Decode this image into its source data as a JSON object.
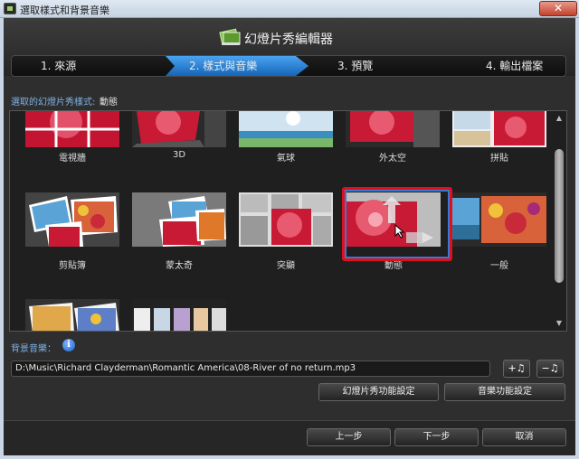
{
  "window": {
    "title": "選取樣式和背景音樂",
    "close_glyph": "✕"
  },
  "header": {
    "app_title": "幻燈片秀編輯器"
  },
  "steps": [
    {
      "label": "1. 來源",
      "active": false
    },
    {
      "label": "2. 樣式與音樂",
      "active": true
    },
    {
      "label": "3. 預覽",
      "active": false
    },
    {
      "label": "4. 輸出檔案",
      "active": false
    }
  ],
  "style_selection": {
    "label": "選取的幻燈片秀樣式:",
    "value": "動態"
  },
  "styles": [
    {
      "label": "電視牆"
    },
    {
      "label": "3D"
    },
    {
      "label": "氣球"
    },
    {
      "label": "外太空"
    },
    {
      "label": "拼貼"
    },
    {
      "label": "剪貼簿"
    },
    {
      "label": "蒙太奇"
    },
    {
      "label": "突顯"
    },
    {
      "label": "動態",
      "selected": true
    },
    {
      "label": "一般"
    },
    {
      "label": ""
    },
    {
      "label": ""
    }
  ],
  "music": {
    "label": "背景音樂：",
    "path": "D:\\Music\\Richard Clayderman\\Romantic America\\08-River of no return.mp3",
    "add_button": "+♫",
    "remove_button": "−♫",
    "slideshow_settings": "幻燈片秀功能設定",
    "music_settings": "音樂功能設定"
  },
  "buttons": {
    "back": "上一步",
    "next": "下一步",
    "cancel": "取消"
  },
  "colors": {
    "accent": "#1f7fd6",
    "selection": "#e0101a",
    "label_blue": "#7fb2e6"
  }
}
